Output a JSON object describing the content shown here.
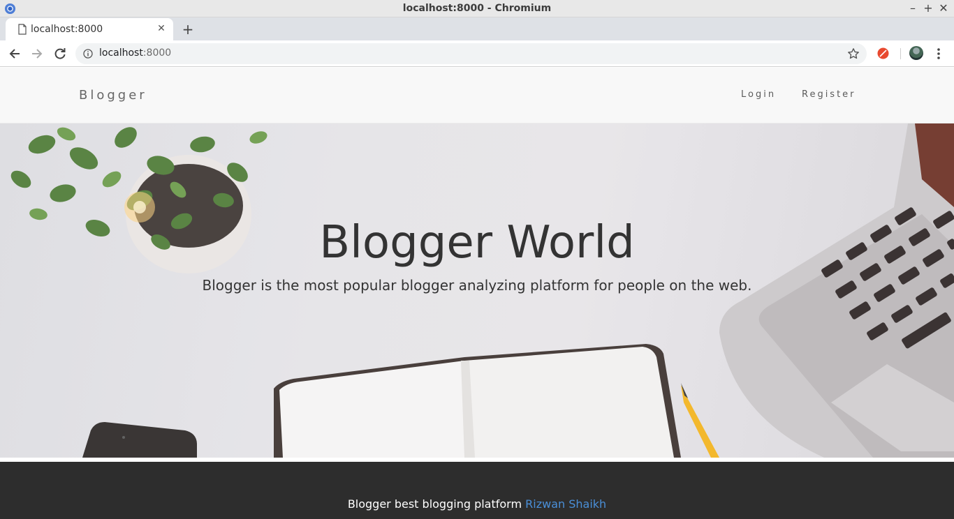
{
  "window": {
    "title": "localhost:8000 - Chromium"
  },
  "tab": {
    "title": "localhost:8000",
    "new_tab_symbol": "+"
  },
  "toolbar": {
    "url_host": "localhost",
    "url_port": ":8000"
  },
  "site": {
    "brand": "Blogger",
    "nav": {
      "login": "Login",
      "register": "Register"
    }
  },
  "hero": {
    "title": "Blogger World",
    "subtitle": "Blogger is the most popular blogger analyzing platform for people on the web."
  },
  "footer": {
    "text": "Blogger best blogging platform ",
    "author_link": "Rizwan Shaikh"
  },
  "colors": {
    "footer_bg": "#2d2d2d",
    "footer_link": "#4a8fd8",
    "nav_bg": "#f8f8f8",
    "extension_accent": "#e8492f"
  },
  "icons": [
    "chromium-logo",
    "page-icon",
    "close-icon",
    "back-arrow-icon",
    "forward-arrow-icon",
    "reload-icon",
    "info-icon",
    "star-icon",
    "extension-icon",
    "avatar",
    "kebab-menu-icon"
  ]
}
